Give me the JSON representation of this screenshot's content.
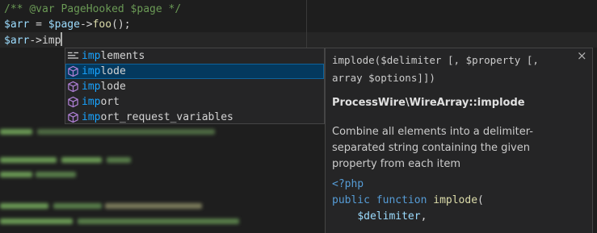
{
  "editor": {
    "lines": [
      {
        "comment_open": "/** ",
        "comment_tag": "@var",
        "comment_type": " PageHooked",
        "comment_var": " $page",
        "comment_close": " */"
      },
      {
        "var1": "$arr",
        "op1": " = ",
        "var2": "$page",
        "op2": "->",
        "fn": "foo",
        "op3": "();"
      },
      {
        "var": "$arr",
        "op": "->",
        "typed": "imp"
      }
    ]
  },
  "suggest": {
    "items": [
      {
        "match": "imp",
        "rest": "lements",
        "icon": "keyword-snippet-icon",
        "selected": false
      },
      {
        "match": "imp",
        "rest": "lode",
        "icon": "method-cube-icon",
        "selected": true
      },
      {
        "match": "imp",
        "rest": "lode",
        "icon": "method-cube-icon",
        "selected": false
      },
      {
        "match": "imp",
        "rest": "ort",
        "icon": "method-cube-icon",
        "selected": false
      },
      {
        "match": "imp",
        "rest": "ort_request_variables",
        "icon": "method-cube-icon",
        "selected": false
      }
    ]
  },
  "details": {
    "signature": "implode($delimiter [, $property [, array $options]])",
    "close_icon": "close-icon",
    "title": "ProcessWire\\WireArray::implode",
    "description": "Combine all elements into a delimiter-separated string containing the given property from each item",
    "code": {
      "php_open": "<?php",
      "kw1": "public",
      "kw2": " function ",
      "fn": "implode",
      "paren": "(",
      "param1": "$delimiter",
      "comma1": ","
    }
  },
  "colors": {
    "background": "#1e1e1e",
    "match_highlight": "#18a3ff",
    "selection": "#04395e",
    "icon_purple": "#b180d7"
  }
}
